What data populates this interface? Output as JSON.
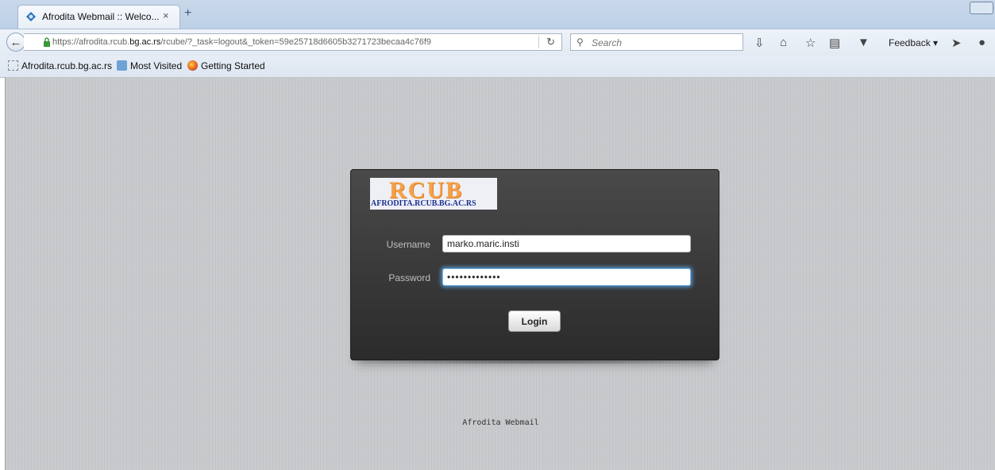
{
  "browser": {
    "tab": {
      "title": "Afrodita Webmail :: Welco...",
      "close": "×"
    },
    "new_tab": "+",
    "url": {
      "prefix": "https://afrodita.rcub.",
      "domain": "bg.ac.rs",
      "path": "/rcube/?_task=logout&_token=59e25718d6605b3271723becaa4c76f9"
    },
    "search": {
      "placeholder": "Search"
    },
    "feedback_label": "Feedback",
    "bookmarks": [
      {
        "label": "Afrodita.rcub.bg.ac.rs",
        "icon": "page-icon"
      },
      {
        "label": "Most Visited",
        "icon": "most-visited-icon"
      },
      {
        "label": "Getting Started",
        "icon": "firefox-icon"
      }
    ]
  },
  "login": {
    "logo_text": "RCUB",
    "logo_subtext": "AFRODITA.RCUB.BG.AC.RS",
    "username_label": "Username",
    "username_value": "marko.maric.insti",
    "password_label": "Password",
    "password_value": "•••••••••••••",
    "login_button": "Login"
  },
  "footer": "Afrodita Webmail",
  "colors": {
    "page_bg": "#c7c9cc",
    "box_bg": "#333333",
    "focus_glow": "#5aaaf0",
    "logo_orange": "#f4a24a",
    "logo_blue": "#1c2f8f"
  }
}
